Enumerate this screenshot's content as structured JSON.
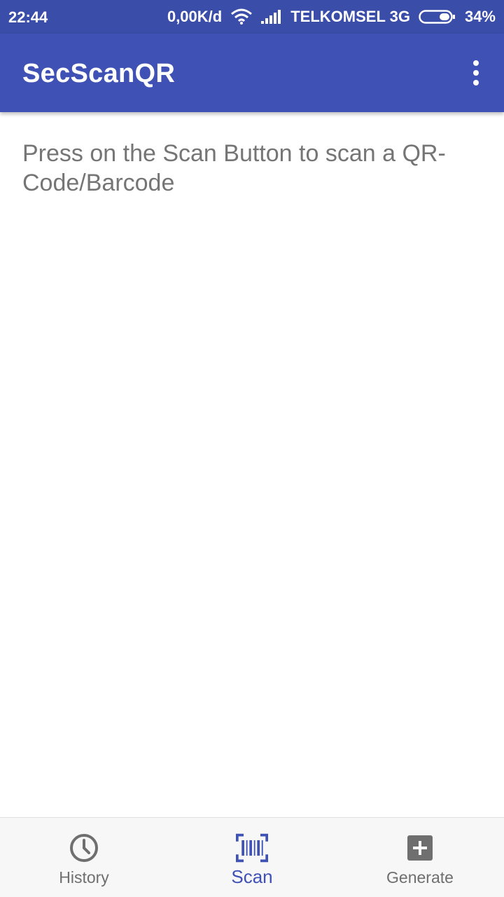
{
  "status_bar": {
    "time": "22:44",
    "network_speed": "0,00K/d",
    "carrier": "TELKOMSEL 3G",
    "battery": "34%",
    "icons": [
      "wifi-icon",
      "signal-icon",
      "battery-icon"
    ]
  },
  "app_bar": {
    "title": "SecScanQR",
    "menu_icon": "more-vert-icon"
  },
  "content": {
    "instruction": "Press on the Scan Button to scan a QR-Code/Barcode"
  },
  "bottom_nav": {
    "items": [
      {
        "label": "History",
        "icon": "history-icon",
        "active": false
      },
      {
        "label": "Scan",
        "icon": "barcode-scan-icon",
        "active": true
      },
      {
        "label": "Generate",
        "icon": "add-box-icon",
        "active": false
      }
    ]
  },
  "colors": {
    "primary": "#3f51b5",
    "status_bar": "#3a4da8",
    "inactive": "#6f6f6f",
    "text_secondary": "#757575"
  }
}
